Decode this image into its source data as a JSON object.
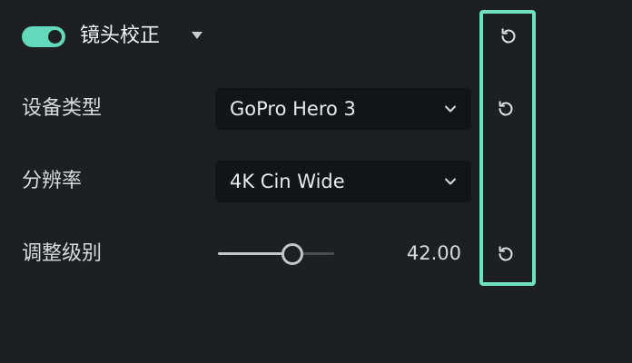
{
  "header": {
    "toggle_on": true,
    "title": "镜头校正",
    "icons": [
      "toggle-switch",
      "caret-down-icon",
      "reset-icon"
    ]
  },
  "rows": {
    "device": {
      "label": "设备类型",
      "value": "GoPro Hero 3",
      "icons": [
        "chevron-down-icon",
        "reset-icon"
      ]
    },
    "resolution": {
      "label": "分辨率",
      "value": "4K Cin Wide",
      "icons": [
        "chevron-down-icon"
      ]
    },
    "adjust": {
      "label": "调整级别",
      "value": "42.00",
      "slider_fraction": 0.64,
      "icons": [
        "reset-icon"
      ]
    }
  },
  "colors": {
    "background": "#1d1f22",
    "accent": "#63d8ba",
    "highlight": "#6fe0c0",
    "dropdown_bg": "#121416",
    "text": "#e6e8ea"
  }
}
